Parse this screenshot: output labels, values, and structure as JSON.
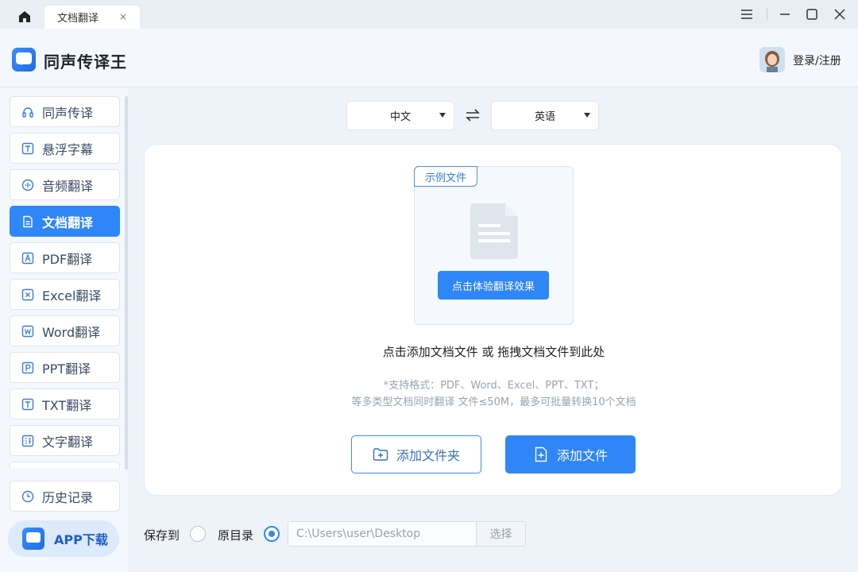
{
  "titlebar": {
    "home_icon": "home-icon",
    "tab_label": "文档翻译",
    "tab_close": "×",
    "controls": [
      "menu-icon",
      "minimize-icon",
      "maximize-icon",
      "close-icon"
    ]
  },
  "header": {
    "app_name": "同声传译王",
    "login_label": "登录/注册"
  },
  "sidebar": {
    "items": [
      {
        "label": "同声传译",
        "icon": "headset-icon",
        "active": false
      },
      {
        "label": "悬浮字幕",
        "icon": "text-box-icon",
        "active": false
      },
      {
        "label": "音频翻译",
        "icon": "audio-wave-icon",
        "active": false
      },
      {
        "label": "文档翻译",
        "icon": "document-icon",
        "active": true
      },
      {
        "label": "PDF翻译",
        "icon": "pdf-icon",
        "active": false
      },
      {
        "label": "Excel翻译",
        "icon": "excel-icon",
        "active": false
      },
      {
        "label": "Word翻译",
        "icon": "word-icon",
        "active": false
      },
      {
        "label": "PPT翻译",
        "icon": "ppt-icon",
        "active": false
      },
      {
        "label": "TXT翻译",
        "icon": "txt-icon",
        "active": false
      },
      {
        "label": "文字翻译",
        "icon": "translate-text-icon",
        "active": false
      }
    ],
    "history_label": "历史记录",
    "app_download_label": "APP下载"
  },
  "main": {
    "source_lang": "中文",
    "target_lang": "英语",
    "sample_tag": "示例文件",
    "try_button": "点击体验翻译效果",
    "drop_text": "点击添加文档文件 或 拖拽文档文件到此处",
    "hint_line1": "*支持格式：PDF、Word、Excel、PPT、TXT；",
    "hint_line2": "等多类型文档同时翻译 文件≤50M，最多可批量转换10个文档",
    "add_folder": "添加文件夹",
    "add_file": "添加文件"
  },
  "save": {
    "label": "保存到",
    "option_original": "原目录",
    "path_value": "C:\\Users\\user\\Desktop",
    "choose_button": "选择"
  },
  "colors": {
    "accent": "#2f86f6",
    "background": "#eef3f9"
  }
}
